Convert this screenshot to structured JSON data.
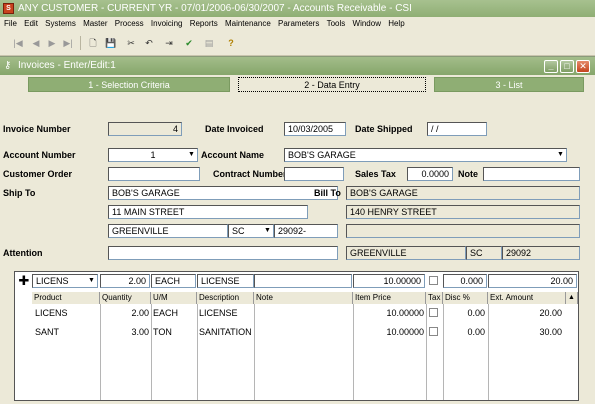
{
  "app_title": "ANY CUSTOMER - CURRENT YR - 07/01/2006-06/30/2007 - Accounts Receivable - CSI",
  "menu": [
    "File",
    "Edit",
    "Systems",
    "Master",
    "Process",
    "Invoicing",
    "Reports",
    "Maintenance",
    "Parameters",
    "Tools",
    "Window",
    "Help"
  ],
  "window_title": "Invoices - Enter/Edit:1",
  "tabs": [
    "1 - Selection Criteria",
    "2 - Data Entry",
    "3 - List"
  ],
  "form": {
    "invoice_number_label": "Invoice Number",
    "invoice_number": "4",
    "date_invoiced_label": "Date Invoiced",
    "date_invoiced": "10/03/2005",
    "date_shipped_label": "Date Shipped",
    "date_shipped": "/ /",
    "account_number_label": "Account Number",
    "account_number": "1",
    "account_name_label": "Account Name",
    "account_name": "BOB'S GARAGE",
    "customer_order_label": "Customer Order",
    "contract_number_label": "Contract Number",
    "sales_tax_label": "Sales Tax",
    "sales_tax": "0.0000",
    "note_label": "Note",
    "ship_to_label": "Ship To",
    "ship_to_name": "BOB'S GARAGE",
    "ship_to_street": "11 MAIN STREET",
    "ship_to_city": "GREENVILLE",
    "ship_to_state": "SC",
    "ship_to_zip": "29092-",
    "bill_to_label": "Bill To",
    "bill_to_name": "BOB'S GARAGE",
    "bill_to_street": "140 HENRY STREET",
    "bill_to_city": "GREENVILLE",
    "bill_to_state": "SC",
    "bill_to_zip": "29092",
    "attention_label": "Attention"
  },
  "entry_row": {
    "product": "LICENS",
    "quantity": "2.00",
    "um": "EACH",
    "description": "LICENSE",
    "item_price": "10.00000",
    "disc": "0.000",
    "ext_amount": "20.00"
  },
  "grid": {
    "headers": [
      "Product",
      "Quantity",
      "U/M",
      "Description",
      "Note",
      "Item Price",
      "Tax",
      "Disc %",
      "Ext. Amount"
    ],
    "rows": [
      {
        "product": "LICENS",
        "quantity": "2.00",
        "um": "EACH",
        "description": "LICENSE",
        "item_price": "10.00000",
        "disc": "0.00",
        "ext_amount": "20.00"
      },
      {
        "product": "SANT",
        "quantity": "3.00",
        "um": "TON",
        "description": "SANITATION",
        "item_price": "10.00000",
        "disc": "0.00",
        "ext_amount": "30.00"
      }
    ]
  }
}
